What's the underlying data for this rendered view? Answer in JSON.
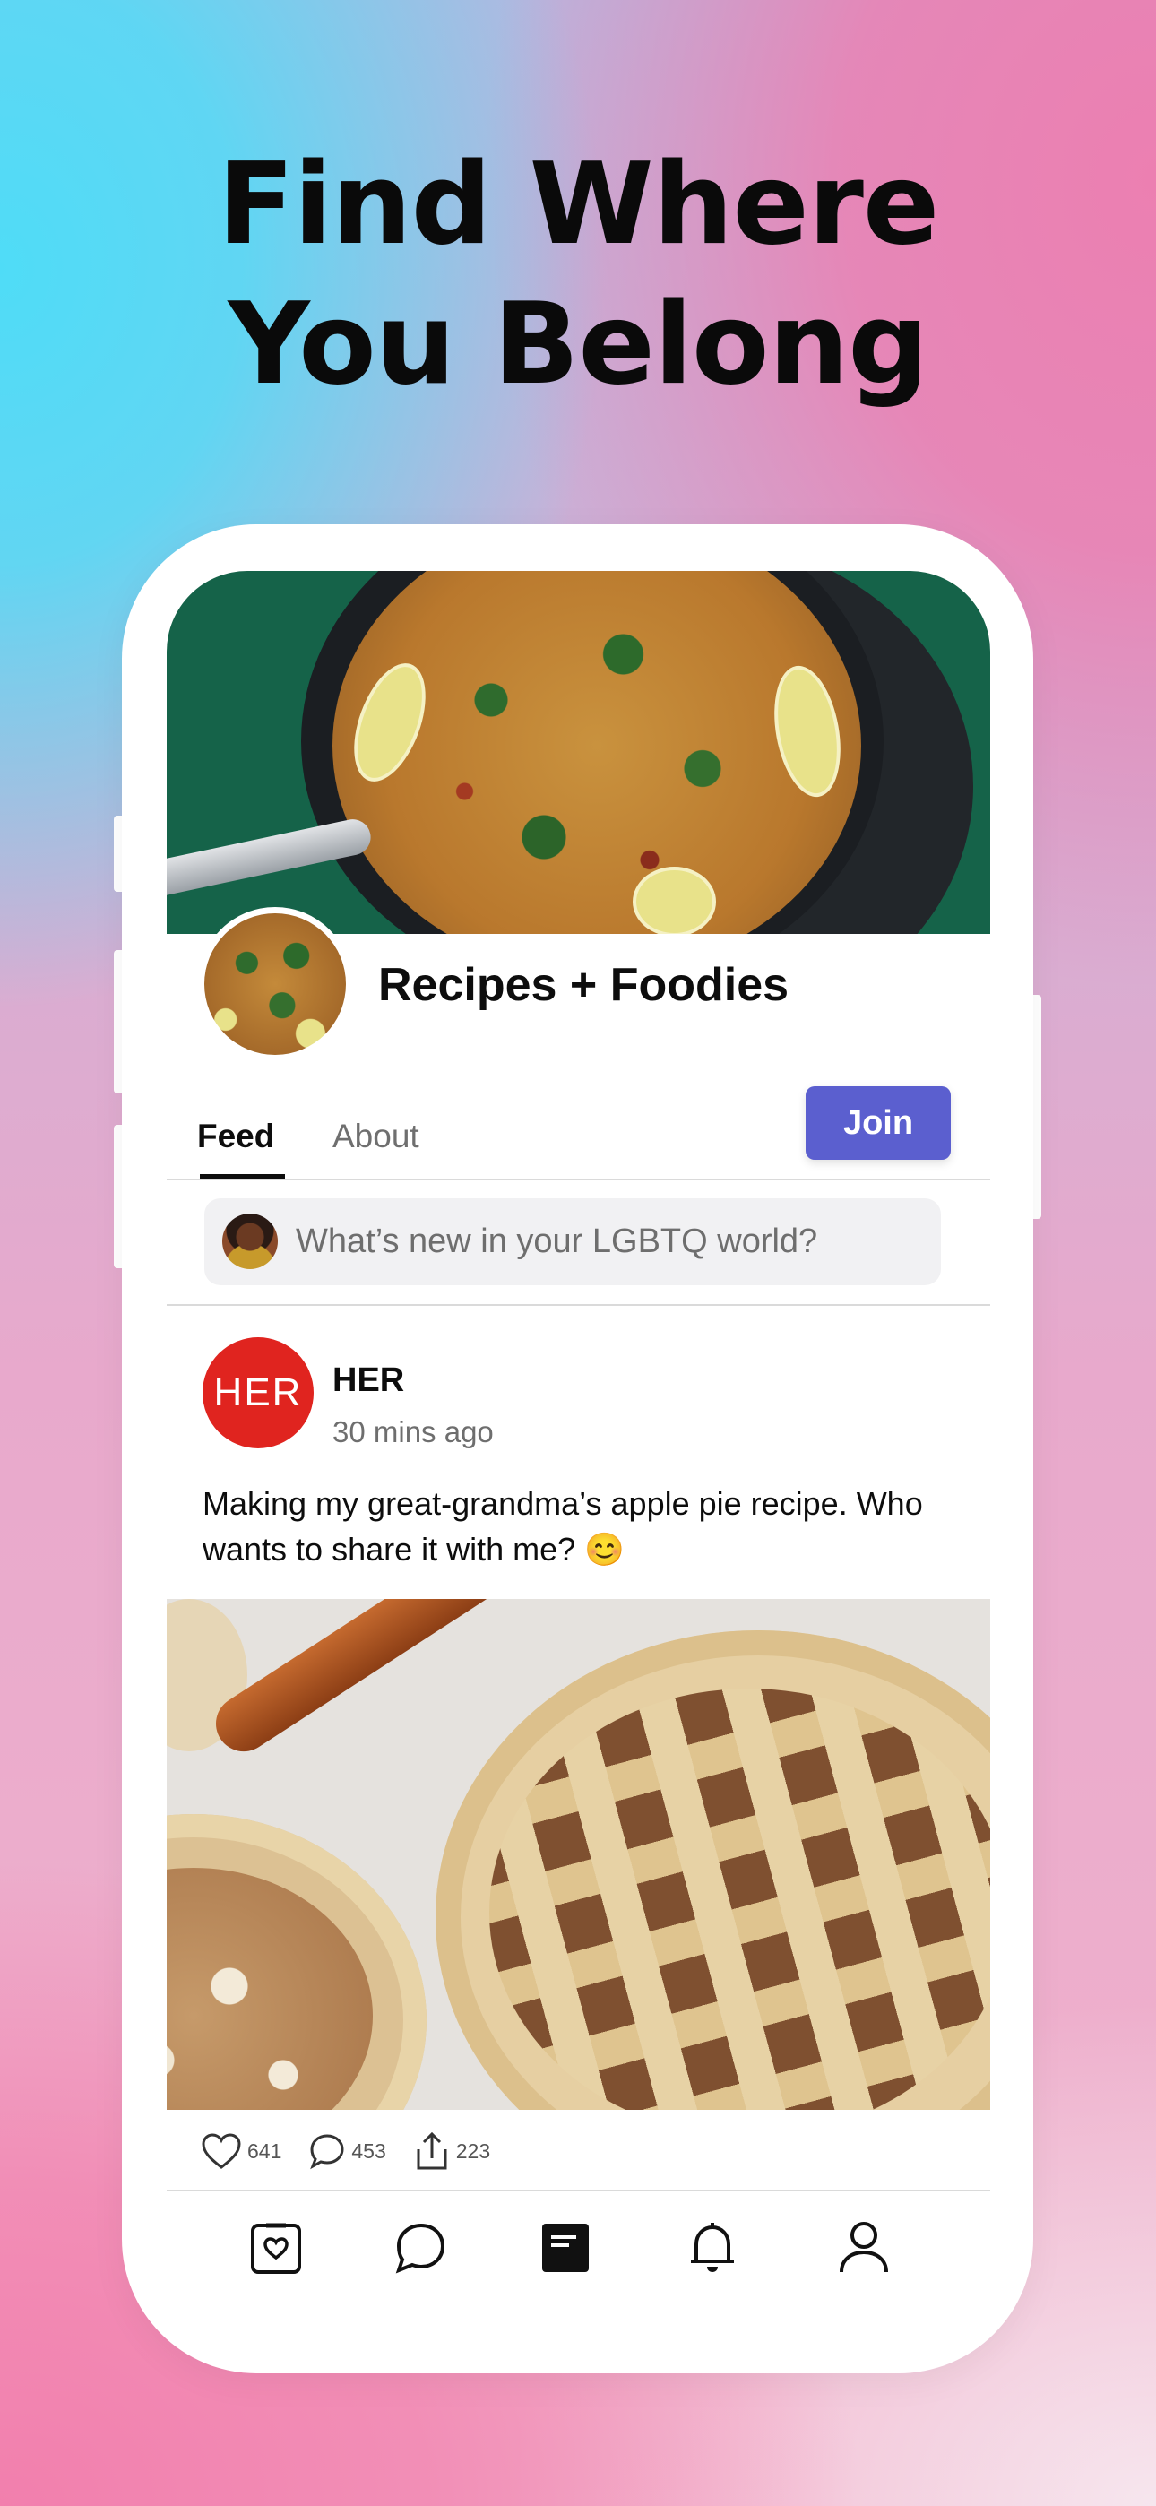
{
  "headline": {
    "line1": "Find Where",
    "line2": "You Belong"
  },
  "group": {
    "title": "Recipes + Foodies",
    "join_label": "Join"
  },
  "tabs": [
    {
      "label": "Feed",
      "active": true
    },
    {
      "label": "About",
      "active": false
    }
  ],
  "composer": {
    "placeholder": "What’s new in your LGBTQ world?"
  },
  "post": {
    "author_logo_text": "HER",
    "author": "HER",
    "time": "30 mins ago",
    "text": "Making my great-grandma’s apple pie recipe. Who wants to share it with me? 😊",
    "likes": "641",
    "comments": "453",
    "shares": "223"
  },
  "bottom_nav": [
    {
      "icon": "heart-square-icon"
    },
    {
      "icon": "chat-bubble-icon"
    },
    {
      "icon": "feed-icon",
      "active": true
    },
    {
      "icon": "bell-icon"
    },
    {
      "icon": "profile-icon"
    }
  ],
  "colors": {
    "accent": "#5b5fcf",
    "her_red": "#e0241f",
    "cover_green": "#156349"
  }
}
